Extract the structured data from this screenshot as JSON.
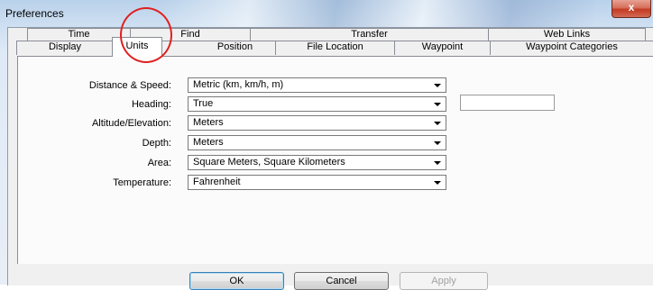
{
  "window": {
    "title": "Preferences",
    "close_glyph": "x"
  },
  "tabs": {
    "back_row": [
      "Time",
      "Find",
      "Transfer",
      "Web Links"
    ],
    "front_row": [
      "Display",
      "Units",
      "Position",
      "File Location",
      "Waypoint",
      "Waypoint Categories"
    ],
    "selected": "Units"
  },
  "form": {
    "distance_speed": {
      "label": "Distance & Speed:",
      "value": "Metric (km, km/h, m)"
    },
    "heading": {
      "label": "Heading:",
      "value": "True",
      "extra_value": ""
    },
    "altitude": {
      "label": "Altitude/Elevation:",
      "value": "Meters"
    },
    "depth": {
      "label": "Depth:",
      "value": "Meters"
    },
    "area": {
      "label": "Area:",
      "value": "Square Meters, Square Kilometers"
    },
    "temperature": {
      "label": "Temperature:",
      "value": "Fahrenheit"
    }
  },
  "buttons": {
    "ok": "OK",
    "cancel": "Cancel",
    "apply": "Apply"
  },
  "colors": {
    "annotation": "#e02020",
    "close_button": "#c43a21"
  }
}
